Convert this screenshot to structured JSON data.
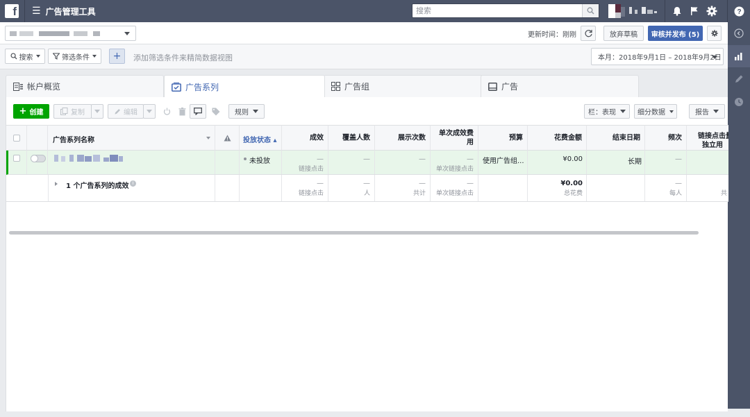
{
  "topbar": {
    "app_title": "广告管理工具",
    "search_placeholder": "搜索",
    "icons": [
      "bell-icon",
      "flag-icon",
      "gear-icon",
      "help-icon"
    ]
  },
  "header": {
    "update_label": "更新时间：刚刚",
    "discard_label": "放弃草稿",
    "publish_label": "审核并发布 (5)"
  },
  "filter": {
    "search_label": "搜索",
    "filter_label": "筛选条件",
    "add_label": "+",
    "hint": "添加筛选条件来精简数据视图",
    "date_range": "本月：2018年9月1日 – 2018年9月2日"
  },
  "tabs": [
    {
      "label": "帐户概览",
      "icon": "account-overview-icon"
    },
    {
      "label": "广告系列",
      "icon": "campaign-icon",
      "active": true
    },
    {
      "label": "广告组",
      "icon": "adset-icon"
    },
    {
      "label": "广告",
      "icon": "ad-icon"
    }
  ],
  "toolbar": {
    "create_label": "创建",
    "duplicate_label": "复制",
    "edit_label": "编辑",
    "rules_label": "规则",
    "columns_label": "栏：表现",
    "breakdown_label": "细分数据",
    "reports_label": "报告"
  },
  "table": {
    "headers": {
      "name": "广告系列名称",
      "delivery": "投放状态 ▴",
      "results": "成效",
      "reach": "覆盖人数",
      "impressions": "展示次数",
      "cost_per_result": "单次成效费用",
      "budget": "预算",
      "amount_spent": "花费金额",
      "end_date": "结束日期",
      "frequency": "频次",
      "link_clicks": "链接点击量",
      "link_clicks_2": "独立用"
    },
    "row": {
      "delivery": "未投放",
      "results": "—",
      "results_sub": "链接点击",
      "reach": "—",
      "impressions": "—",
      "cost_per_result": "—",
      "cost_per_result_sub": "单次链接点击",
      "budget": "使用广告组...",
      "amount_spent": "¥0.00",
      "end_date": "长期",
      "frequency": "—"
    },
    "summary": {
      "label": "1 个广告系列的成效",
      "results": "—",
      "results_sub": "链接点击",
      "reach": "—",
      "reach_sub": "人",
      "impressions": "—",
      "impressions_sub": "共计",
      "cost_per_result": "—",
      "cost_per_result_sub": "单次链接点击",
      "amount_spent": "¥0.00",
      "amount_spent_sub": "总花费",
      "frequency": "—",
      "frequency_sub": "每人",
      "link_clicks_sub": "共"
    }
  }
}
